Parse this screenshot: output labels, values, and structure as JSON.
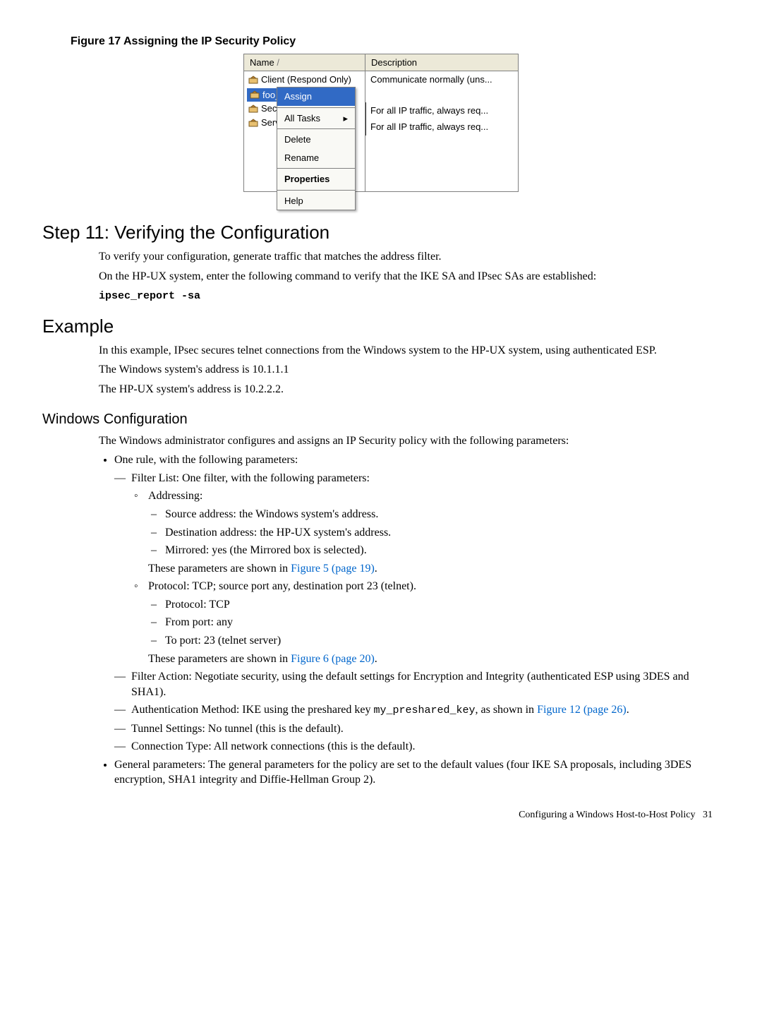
{
  "figure": {
    "caption": "Figure 17 Assigning the IP Security Policy",
    "header_name": "Name",
    "header_desc": "Description",
    "client_respond": "Client (Respond Only)",
    "client_desc": "Communicate normally (uns...",
    "foo_policy": "foo_",
    "secu_label": "Secu",
    "serv_label": "Serv",
    "desc_sec": "For all IP traffic, always req...",
    "desc_srv": "For all IP traffic, always req...",
    "menu": {
      "assign": "Assign",
      "all_tasks": "All Tasks",
      "delete": "Delete",
      "rename": "Rename",
      "properties": "Properties",
      "help": "Help"
    }
  },
  "step11": {
    "heading": "Step 11: Verifying the Configuration",
    "p1": "To verify your configuration, generate traffic that matches the address filter.",
    "p2": "On the HP-UX system, enter the following command to verify that the IKE SA and IPsec SAs are established:",
    "cmd": "ipsec_report -sa"
  },
  "example": {
    "heading": "Example",
    "p1": "In this example, IPsec secures telnet connections from the Windows system to the HP-UX system, using authenticated ESP.",
    "p2": "The Windows system's address is 10.1.1.1",
    "p3": "The HP-UX system's address is 10.2.2.2."
  },
  "winconf": {
    "heading": "Windows Configuration",
    "intro": "The Windows administrator configures and assigns an IP Security policy with the following parameters:",
    "one_rule": "One rule, with the following parameters:",
    "filter_list": "Filter List: One filter, with the following parameters:",
    "addressing": "Addressing:",
    "src": "Source address: the Windows system's address.",
    "dst": "Destination address: the HP-UX system's address.",
    "mirrored": "Mirrored: yes (the Mirrored box is selected).",
    "shown_in": "These parameters are shown in ",
    "fig5": "Figure 5 (page 19)",
    "protocol_line": "Protocol: TCP; source port any, destination port 23 (telnet).",
    "proto_tcp": "Protocol: TCP",
    "from_port": "From port: any",
    "to_port": "To port: 23 (telnet server)",
    "fig6": "Figure 6 (page 20)",
    "filter_action": "Filter Action: Negotiate security, using the default settings for Encryption and Integrity (authenticated ESP using 3DES and SHA1).",
    "auth_pre": "Authentication Method: IKE using the preshared key ",
    "auth_key": "my_preshared_key",
    "auth_post": ", as shown in ",
    "fig12": "Figure 12 (page 26)",
    "tunnel": "Tunnel Settings: No tunnel (this is the default).",
    "conn_type": "Connection Type: All network connections (this is the default).",
    "general": "General parameters: The general parameters for the policy are set to the default values (four IKE SA proposals, including 3DES encryption, SHA1 integrity and Diffie-Hellman Group 2)."
  },
  "footer": {
    "text": "Configuring a Windows Host-to-Host Policy",
    "page": "31"
  },
  "periods": {
    "dot": "."
  }
}
